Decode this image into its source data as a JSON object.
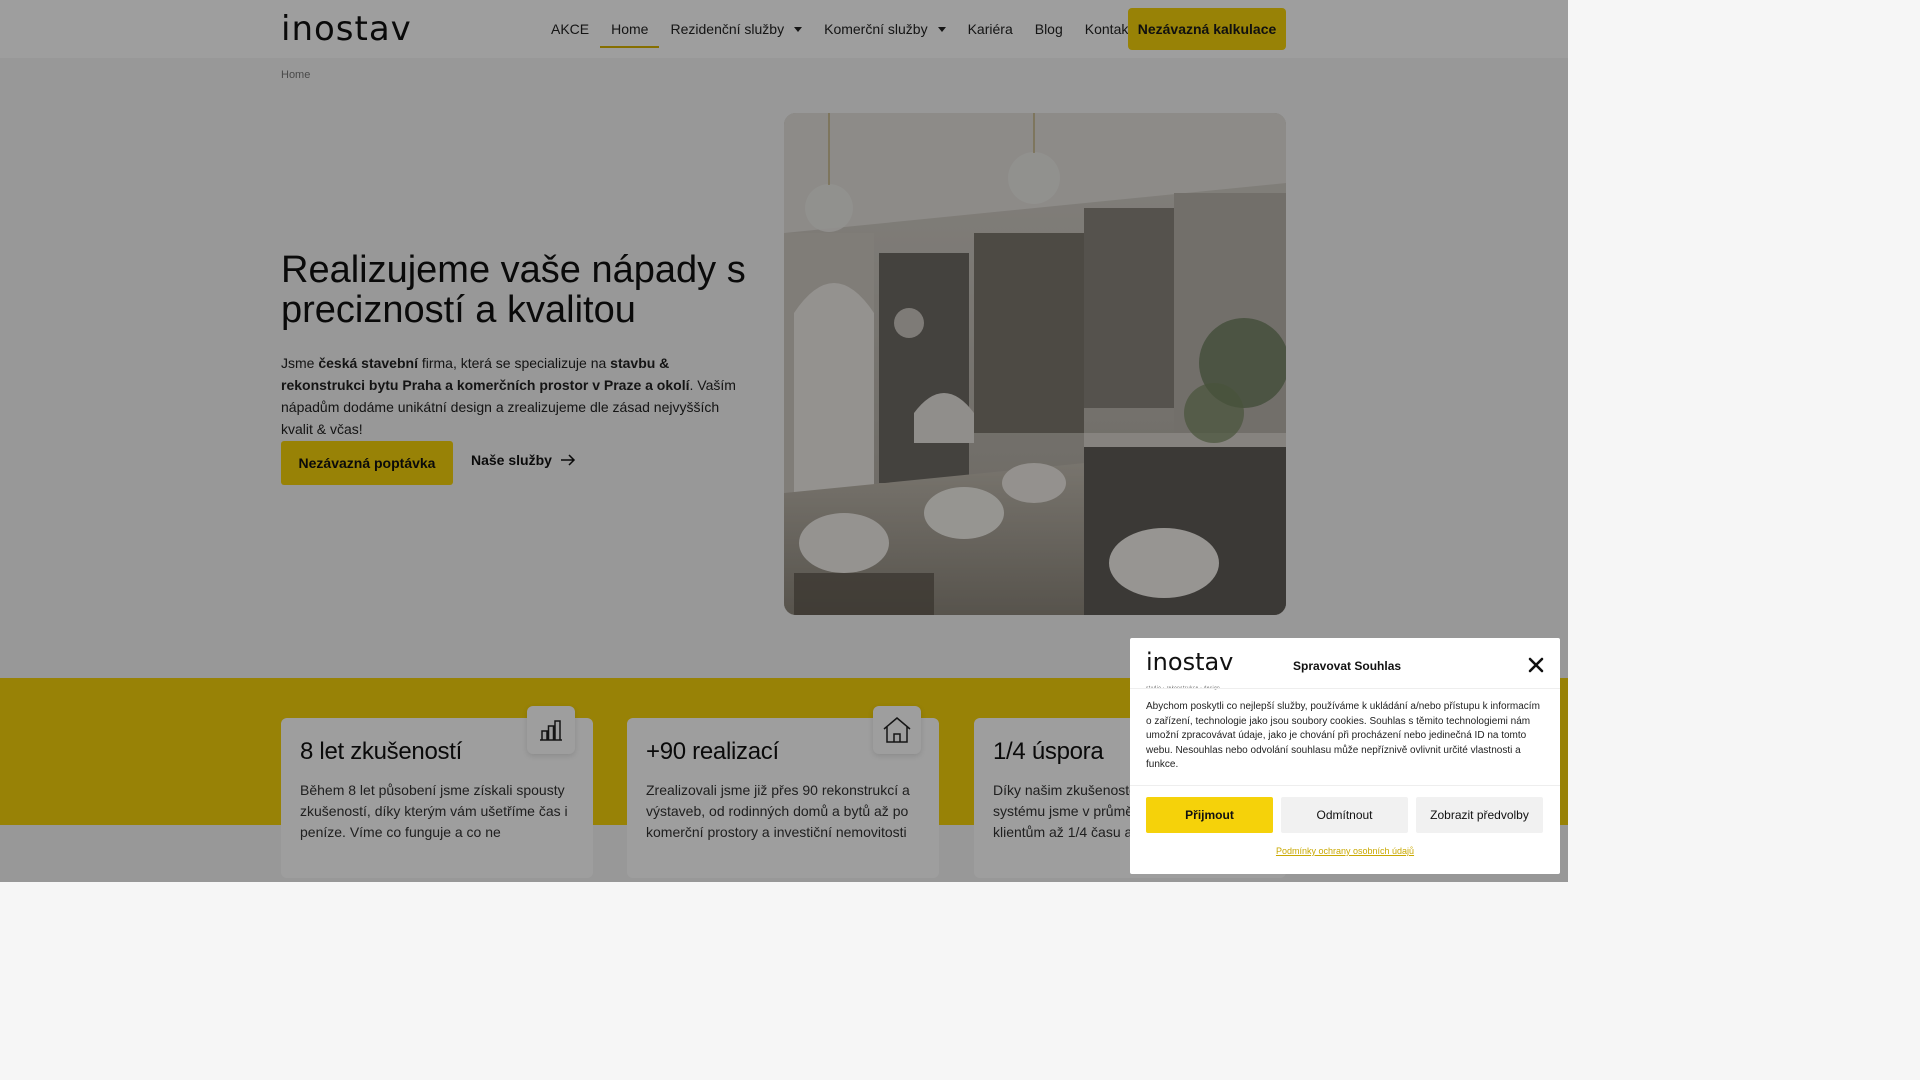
{
  "header": {
    "logo": "inostav",
    "nav": [
      {
        "label": "AKCE",
        "dropdown": false,
        "active": false
      },
      {
        "label": "Home",
        "dropdown": false,
        "active": true
      },
      {
        "label": "Rezidenční služby",
        "dropdown": true,
        "active": false
      },
      {
        "label": "Komerční služby",
        "dropdown": true,
        "active": false
      },
      {
        "label": "Kariéra",
        "dropdown": false,
        "active": false
      },
      {
        "label": "Blog",
        "dropdown": false,
        "active": false
      },
      {
        "label": "Kontakt",
        "dropdown": false,
        "active": false
      }
    ],
    "cta_label": "Nezávazná kalkulace"
  },
  "breadcrumb": "Home",
  "hero": {
    "title": "Realizujeme vaše nápady s precizností a kvalitou",
    "text": {
      "p1": "Jsme ",
      "b1": "česká stavební",
      "p2": " firma, která se specializuje na ",
      "b2": "stavbu & rekonstrukci bytu Praha a komerčních prostor v Praze a okolí",
      "p3": ". Vaším nápadům dodáme unikátní design a zrealizujeme dle zásad nejvyšších kvalit & včas!"
    },
    "primary_button": "Nezávazná poptávka",
    "secondary_link": "Naše služby"
  },
  "stats": [
    {
      "title": "8 let zkušeností",
      "text": "Během 8 let působení jsme získali spousty zkušeností, díky kterým vám ušetříme čas i peníze. Víme co funguje a co ne",
      "icon": "bar-chart-icon"
    },
    {
      "title": "+90 realizací",
      "text": "Zrealizovali jsme již přes 90 rekonstrukcí a výstaveb, od rodinných domů a bytů až po komerční prostory a investiční nemovitosti",
      "icon": "house-icon"
    },
    {
      "title": "1/4 úspora",
      "text": "Díky našim zkušenostem a efektivnímu systému jsme v průměru ušetřili našim klientům až 1/4 času a peněz",
      "icon": "savings-icon"
    }
  ],
  "cookie": {
    "logo": "inostav",
    "logo_tagline": "studio · rekonstrukce · design",
    "title": "Spravovat Souhlas",
    "text": "Abychom poskytli co nejlepší služby, používáme k ukládání a/nebo přístupu k informacím o zařízení, technologie jako jsou soubory cookies. Souhlas s těmito technologiemi nám umožní zpracovávat údaje, jako je chování při procházení nebo jedinečná ID na tomto webu. Nesouhlas nebo odvolání souhlasu může nepříznivě ovlivnit určité vlastnosti a funkce.",
    "accept": "Přijmout",
    "deny": "Odmítnout",
    "preferences": "Zobrazit předvolby",
    "privacy_link": "Podmínky ochrany osobních údajů"
  },
  "colors": {
    "accent": "#f5d20a"
  }
}
